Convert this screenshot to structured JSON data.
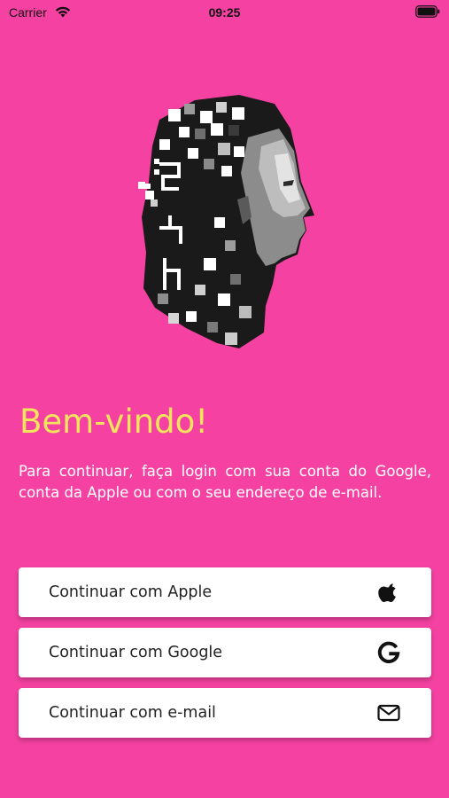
{
  "theme": {
    "background": "#F542A2",
    "title_color": "#F2E45C",
    "text_color": "#FFFFFF",
    "button_bg": "#FFFFFF"
  },
  "status_bar": {
    "carrier": "Carrier",
    "time": "09:25",
    "wifi_icon": "wifi-icon",
    "battery_icon": "battery-full-icon"
  },
  "hero": {
    "icon": "pixelated-portrait-illustration"
  },
  "welcome": {
    "title": "Bem-vindo!",
    "message": "Para continuar, faça login com sua conta do Google, conta da Apple ou com o seu endereço de e-mail."
  },
  "buttons": [
    {
      "label": "Continuar com Apple",
      "icon": "apple-logo-icon"
    },
    {
      "label": "Continuar com Google",
      "icon": "google-g-icon"
    },
    {
      "label": "Continuar com e-mail",
      "icon": "envelope-icon"
    }
  ]
}
